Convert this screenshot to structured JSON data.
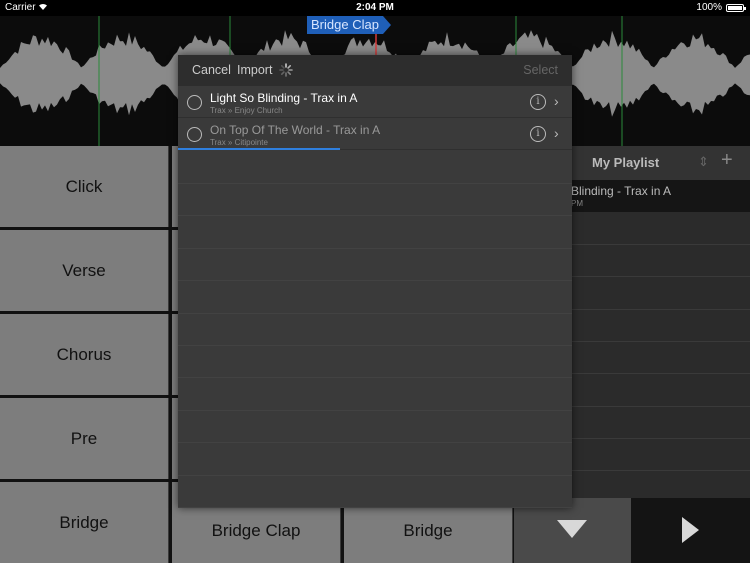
{
  "status": {
    "carrier": "Carrier",
    "time": "2:04 PM",
    "battery": "100%"
  },
  "cue_label": "Bridge Clap",
  "pads": {
    "left": [
      "Click",
      "Verse",
      "Chorus",
      "Pre",
      "Bridge"
    ],
    "bottom": [
      "Bridge Clap",
      "Bridge"
    ]
  },
  "playlist": {
    "title": "My Playlist",
    "first_title": "Blinding - Trax in A",
    "first_sub": "PM"
  },
  "modal": {
    "cancel": "Cancel",
    "import": "Import",
    "select": "Select",
    "progress": 0.41,
    "items": [
      {
        "title": "Light So Blinding - Trax in A",
        "subtitle": "Trax » Enjoy Church"
      },
      {
        "title": "On Top Of The World - Trax in A",
        "subtitle": "Trax » Citipointe"
      }
    ]
  },
  "colors": {
    "accent": "#1f5fb8",
    "progress": "#2f7fde",
    "marker_green": "#2a8a3a",
    "playhead": "#d43a3a"
  }
}
